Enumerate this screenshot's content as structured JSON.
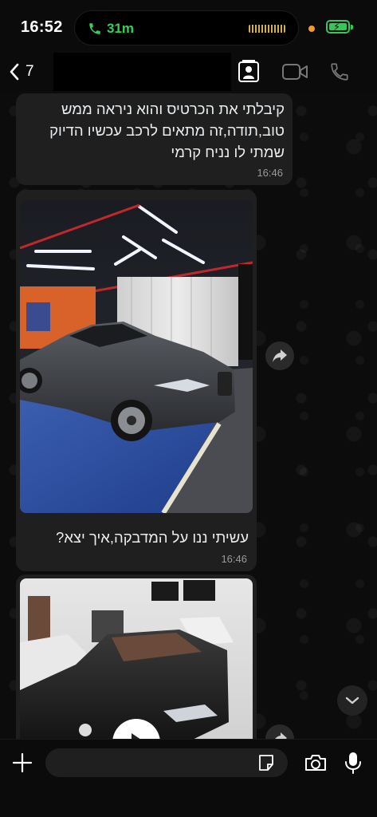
{
  "status": {
    "time": "16:52",
    "call_duration": "31m"
  },
  "header": {
    "back_count": "7"
  },
  "messages": [
    {
      "text": "קיבלתי את הכרטיס והוא ניראה ממש טוב,תודה,זה מתאים לרכב עכשיו הדיוק שמתי לו נניח קרמי",
      "time": "16:46"
    },
    {
      "caption": "עשיתי ננו על המדבקה,איך יצא?",
      "time": "16:46"
    }
  ],
  "input": {
    "placeholder": ""
  },
  "icons": {
    "back": "chevron-left-icon",
    "contact": "contact-card-icon",
    "video": "video-call-icon",
    "call": "phone-icon",
    "forward": "forward-icon",
    "scroll_down": "chevron-down-icon",
    "attach": "plus-icon",
    "sticker": "sticker-icon",
    "camera": "camera-icon",
    "mic": "microphone-icon"
  },
  "colors": {
    "background": "#0b0b0b",
    "bubble": "#1f1f1f",
    "call_green": "#35d05a",
    "battery_green": "#35c759"
  }
}
